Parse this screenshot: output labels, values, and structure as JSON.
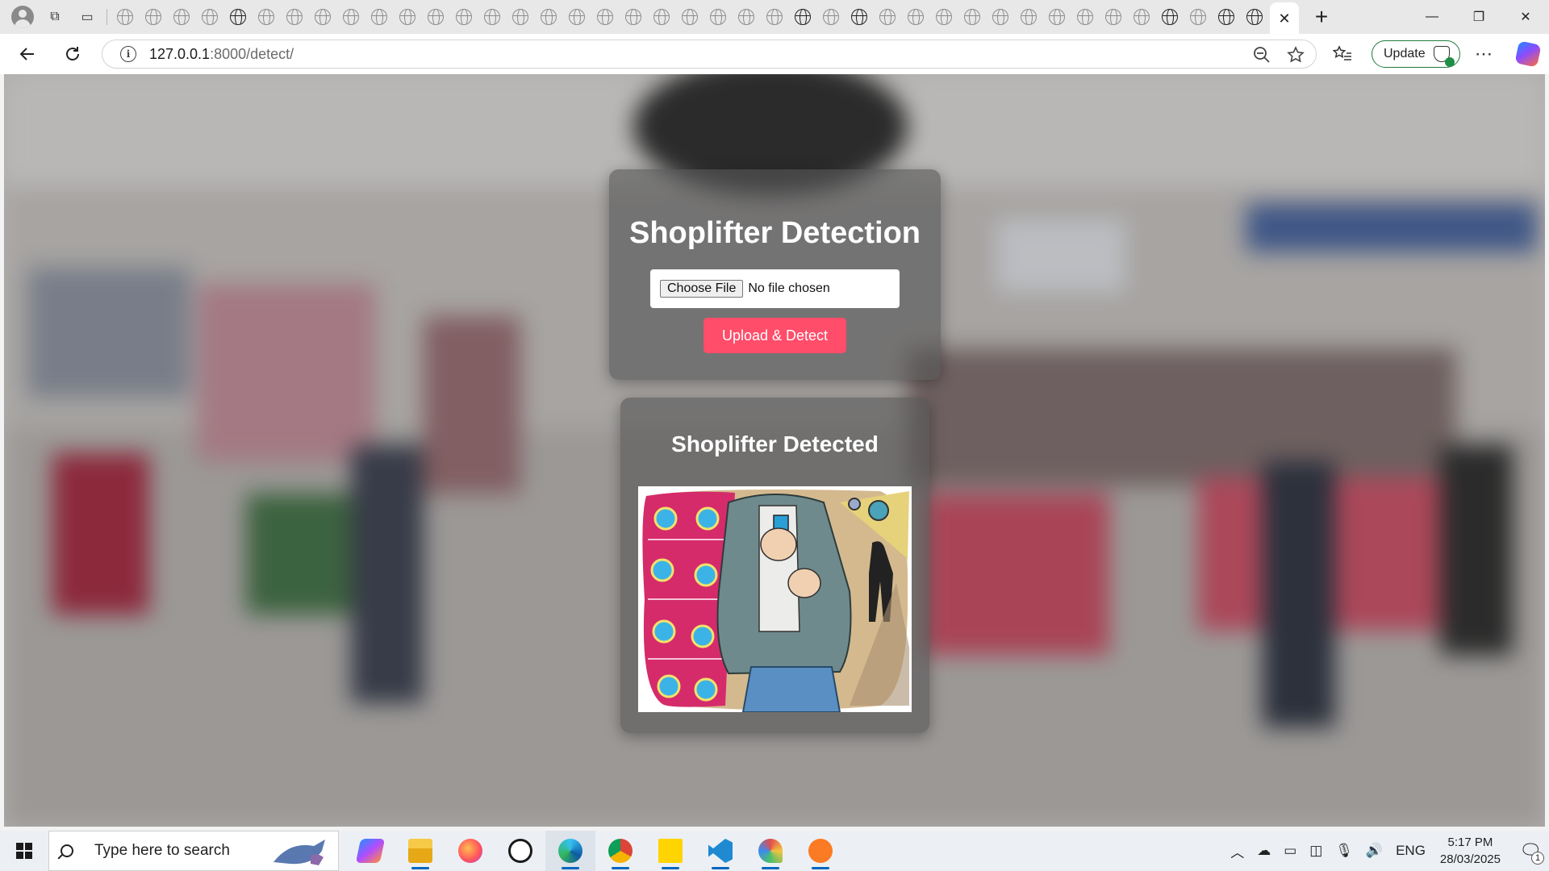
{
  "browser": {
    "tab_count_inactive": 41,
    "active_tab_close_glyph": "✕",
    "new_tab_glyph": "+",
    "window_controls": {
      "minimize": "—",
      "restore": "❐",
      "close": "✕"
    },
    "address": {
      "host": "127.0.0.1",
      "path": ":8000/detect/"
    },
    "update_label": "Update",
    "icons": {
      "back": "arrow-left-icon",
      "refresh": "refresh-icon",
      "info": "info-icon",
      "zoom": "zoom-out-icon",
      "favorite": "star-icon",
      "favorites_list": "favorites-list-icon",
      "menu": "more-icon",
      "copilot": "copilot-icon"
    }
  },
  "page": {
    "upload_card": {
      "title": "Shoplifter Detection",
      "choose_file_label": "Choose File",
      "no_file_text": "No file chosen",
      "submit_label": "Upload & Detect"
    },
    "result_card": {
      "title": "Shoplifter Detected"
    },
    "colors": {
      "accent": "#ff4d6a",
      "card_bg": "rgba(85,85,85,0.62)"
    }
  },
  "taskbar": {
    "search_placeholder": "Type here to search",
    "apps": [
      "copilot",
      "file-explorer",
      "firefox",
      "whatsapp",
      "edge",
      "chrome",
      "sticky-notes",
      "vscode",
      "paint",
      "xampp"
    ],
    "active_app": "edge",
    "tray": {
      "language": "ENG",
      "time": "5:17 PM",
      "date": "28/03/2025",
      "notification_count": "1"
    }
  }
}
